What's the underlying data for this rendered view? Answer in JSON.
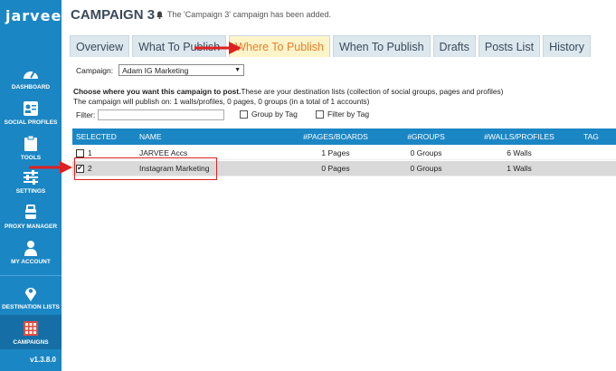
{
  "app": {
    "logo": "jarvee",
    "version": "v1.3.8.0"
  },
  "sidebar": {
    "items": [
      {
        "label": "DASHBOARD",
        "icon": "dashboard-icon"
      },
      {
        "label": "SOCIAL PROFILES",
        "icon": "social-profiles-icon"
      },
      {
        "label": "TOOLS",
        "icon": "tools-icon"
      },
      {
        "label": "SETTINGS",
        "icon": "settings-icon"
      },
      {
        "label": "PROXY MANAGER",
        "icon": "proxy-manager-icon"
      },
      {
        "label": "MY ACCOUNT",
        "icon": "account-icon"
      },
      {
        "label": "DESTINATION LISTS",
        "icon": "map-pin-icon"
      },
      {
        "label": "CAMPAIGNS",
        "icon": "campaigns-icon"
      }
    ],
    "active": "CAMPAIGNS"
  },
  "header": {
    "title": "CAMPAIGN 3",
    "notice": "The 'Campaign 3' campaign has been added."
  },
  "tabs": [
    {
      "label": "Overview"
    },
    {
      "label": "What To Publish"
    },
    {
      "label": "Where To Publish"
    },
    {
      "label": "When To Publish"
    },
    {
      "label": "Drafts"
    },
    {
      "label": "Posts List"
    },
    {
      "label": "History"
    }
  ],
  "active_tab": "Where To Publish",
  "campaign": {
    "label": "Campaign:",
    "selected": "Adam IG Marketing"
  },
  "instructions": {
    "bold": "Choose where you want this campaign to post.",
    "rest": "These are your destination lists (collection of social groups, pages and profiles)",
    "summary": "The campaign will publish on: 1 walls/profiles, 0 pages, 0 groups (in a total of 1 accounts)"
  },
  "filter": {
    "label": "Filter:",
    "value": "",
    "group_by_tag": "Group by Tag",
    "filter_by_tag": "Filter by Tag"
  },
  "table": {
    "columns": [
      "SELECTED",
      "NAME",
      "#PAGES/BOARDS",
      "#GROUPS",
      "#WALLS/PROFILES",
      "TAG"
    ],
    "rows": [
      {
        "checked": false,
        "id": "1",
        "name": "JARVEE Accs",
        "pages": "1 Pages",
        "groups": "0 Groups",
        "walls": "6 Walls",
        "tag": ""
      },
      {
        "checked": true,
        "id": "2",
        "name": "Instagram Marketing",
        "pages": "0 Pages",
        "groups": "0 Groups",
        "walls": "1 Walls",
        "tag": ""
      }
    ]
  },
  "colors": {
    "sidebar": "#1b86c4",
    "active_tab_bg": "#fdf4c9",
    "active_tab_text": "#e8802b",
    "annotation": "#e02020"
  }
}
